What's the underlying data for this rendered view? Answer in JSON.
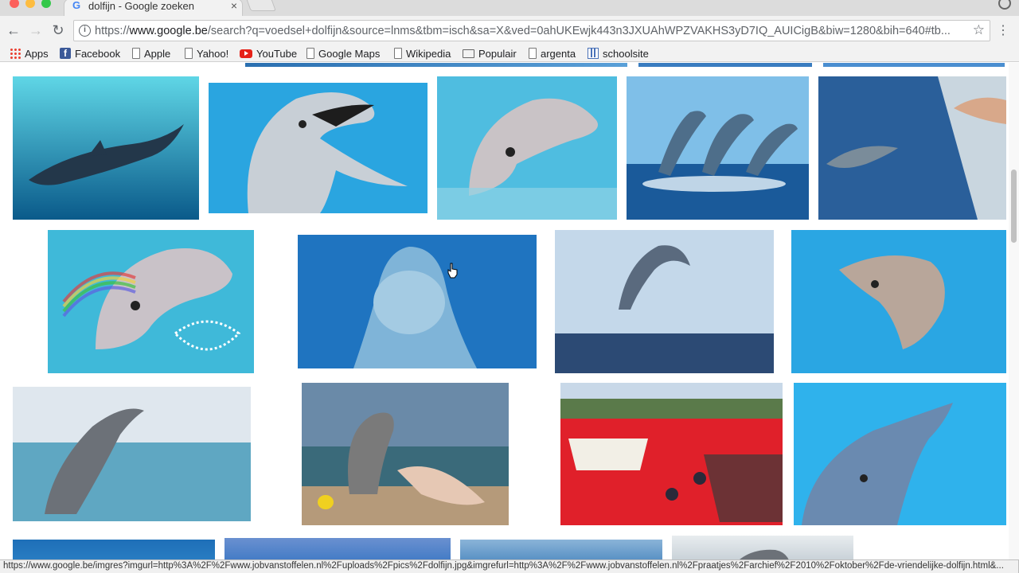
{
  "tab": {
    "title": "dolfijn - Google zoeken",
    "close": "×"
  },
  "toolbar": {
    "back": "←",
    "forward": "→",
    "reload": "↻",
    "info": "i",
    "url_prefix": "https://",
    "url_host": "www.google.be",
    "url_rest": "/search?q=voedsel+dolfijn&source=lnms&tbm=isch&sa=X&ved=0ahUKEwjk443n3JXUAhWPZVAKHS3yD7IQ_AUICigB&biw=1280&bih=640#tb...",
    "star": "☆",
    "menu": "⋮"
  },
  "bookmarks": [
    {
      "label": "Apps",
      "icon": "apps-grid-icon"
    },
    {
      "label": "Facebook",
      "icon": "facebook-icon"
    },
    {
      "label": "Apple",
      "icon": "page-icon"
    },
    {
      "label": "Yahoo!",
      "icon": "page-icon"
    },
    {
      "label": "YouTube",
      "icon": "youtube-icon"
    },
    {
      "label": "Google Maps",
      "icon": "page-icon"
    },
    {
      "label": "Wikipedia",
      "icon": "page-icon"
    },
    {
      "label": "Populair",
      "icon": "folder-icon"
    },
    {
      "label": "argenta",
      "icon": "page-icon"
    },
    {
      "label": "schoolsite",
      "icon": "schoolsite-icon"
    }
  ],
  "images": [
    {
      "alt": "dolfijn zwemt onder water"
    },
    {
      "alt": "dolfijn met open bek"
    },
    {
      "alt": "dolfijn kop boven water"
    },
    {
      "alt": "springende dolfijnen"
    },
    {
      "alt": "dolfijn in bassin"
    },
    {
      "alt": "dolfijn met regenboog"
    },
    {
      "alt": "dolfijn kijkt in camera"
    },
    {
      "alt": "dolfijn springt boven zee"
    },
    {
      "alt": "dolfijn in zwembad"
    },
    {
      "alt": "dolfijn springt uit water"
    },
    {
      "alt": "dolfijn schilderij aan strand"
    },
    {
      "alt": "dolfijnenjacht rode zee"
    },
    {
      "alt": "dolfijn close-up"
    },
    {
      "alt": "zee"
    },
    {
      "alt": "zee"
    },
    {
      "alt": "zee"
    },
    {
      "alt": "dolfijn"
    }
  ],
  "status_url": "https://www.google.be/imgres?imgurl=http%3A%2F%2Fwww.jobvanstoffelen.nl%2Fuploads%2Fpics%2Fdolfijn.jpg&imgrefurl=http%3A%2F%2Fwww.jobvanstoffelen.nl%2Fpraatjes%2Farchief%2F2010%2Foktober%2Fde-vriendelijke-dolfijn.html&..."
}
